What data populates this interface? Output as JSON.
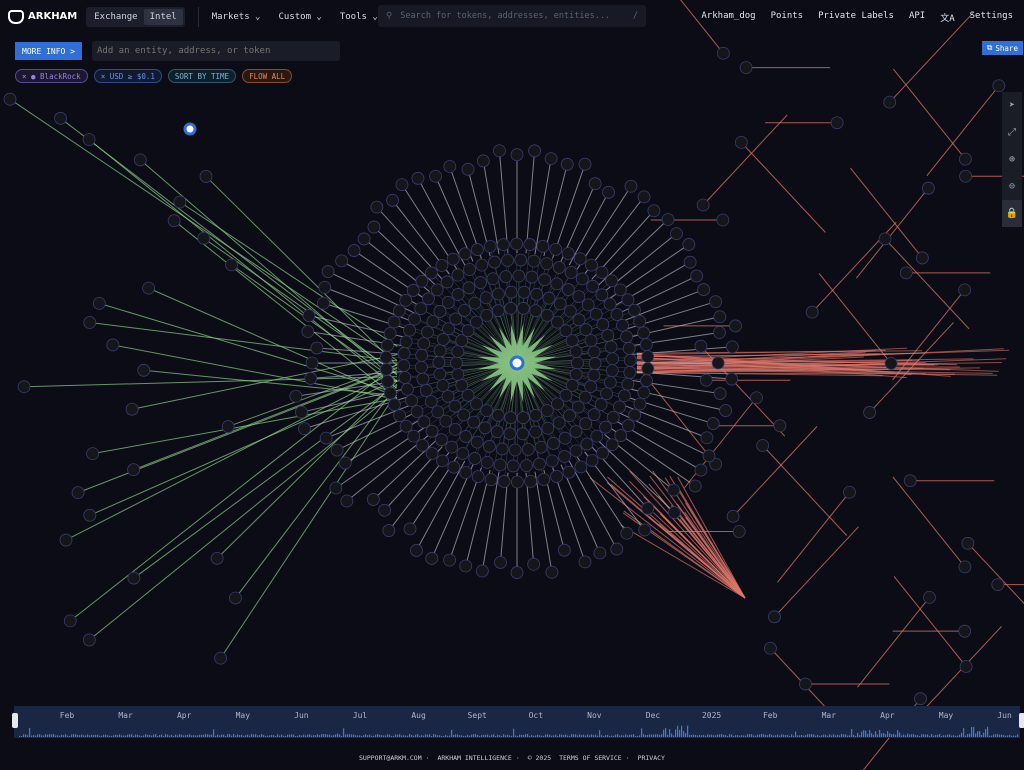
{
  "header": {
    "brand": "ARKHAM",
    "tabs": [
      {
        "label": "Exchange"
      },
      {
        "label": "Intel"
      }
    ],
    "nav": [
      {
        "label": "Markets ⌄"
      },
      {
        "label": "Custom ⌄"
      },
      {
        "label": "Tools ⌄"
      }
    ],
    "search_placeholder": "Search for tokens, addresses, entities...",
    "search_shortcut": "/",
    "right": [
      {
        "label": "Arkham_dog"
      },
      {
        "label": "Points"
      },
      {
        "label": "Private Labels"
      },
      {
        "label": "API"
      },
      {
        "label": "文A"
      },
      {
        "label": "Settings"
      }
    ]
  },
  "toolbar": {
    "more_info": "MORE INFO >",
    "entity_placeholder": "Add an entity, address, or token",
    "share": "Share"
  },
  "filters": [
    {
      "label": "× ● BlackRock"
    },
    {
      "label": "× USD ≥ $0.1"
    },
    {
      "label": "SORT BY TIME"
    },
    {
      "label": "FLOW ALL"
    }
  ],
  "graph_tools": [
    {
      "icon": "cursor-icon",
      "glyph": "➤"
    },
    {
      "icon": "fit-screen-icon",
      "glyph": "⤢"
    },
    {
      "icon": "zoom-in-icon",
      "glyph": "⊕"
    },
    {
      "icon": "zoom-out-icon",
      "glyph": "⊖"
    },
    {
      "icon": "lock-icon",
      "glyph": "🔒"
    }
  ],
  "timeline": {
    "months": [
      "Feb",
      "Mar",
      "Apr",
      "May",
      "Jun",
      "Jul",
      "Aug",
      "Sept",
      "Oct",
      "Nov",
      "Dec",
      "2025",
      "Feb",
      "Mar",
      "Apr",
      "May",
      "Jun"
    ]
  },
  "footer": {
    "support": "SUPPORT@ARKM.COM",
    "company": "ARKHAM INTELLIGENCE",
    "copyright": "© 2025",
    "terms": "TERMS OF SERVICE",
    "privacy": "PRIVACY",
    "sep": "·"
  },
  "colors": {
    "bg": "#0b0c16",
    "accent": "#2f6fd6",
    "inflow": "#8fd08a",
    "outflow": "#e0766a"
  }
}
